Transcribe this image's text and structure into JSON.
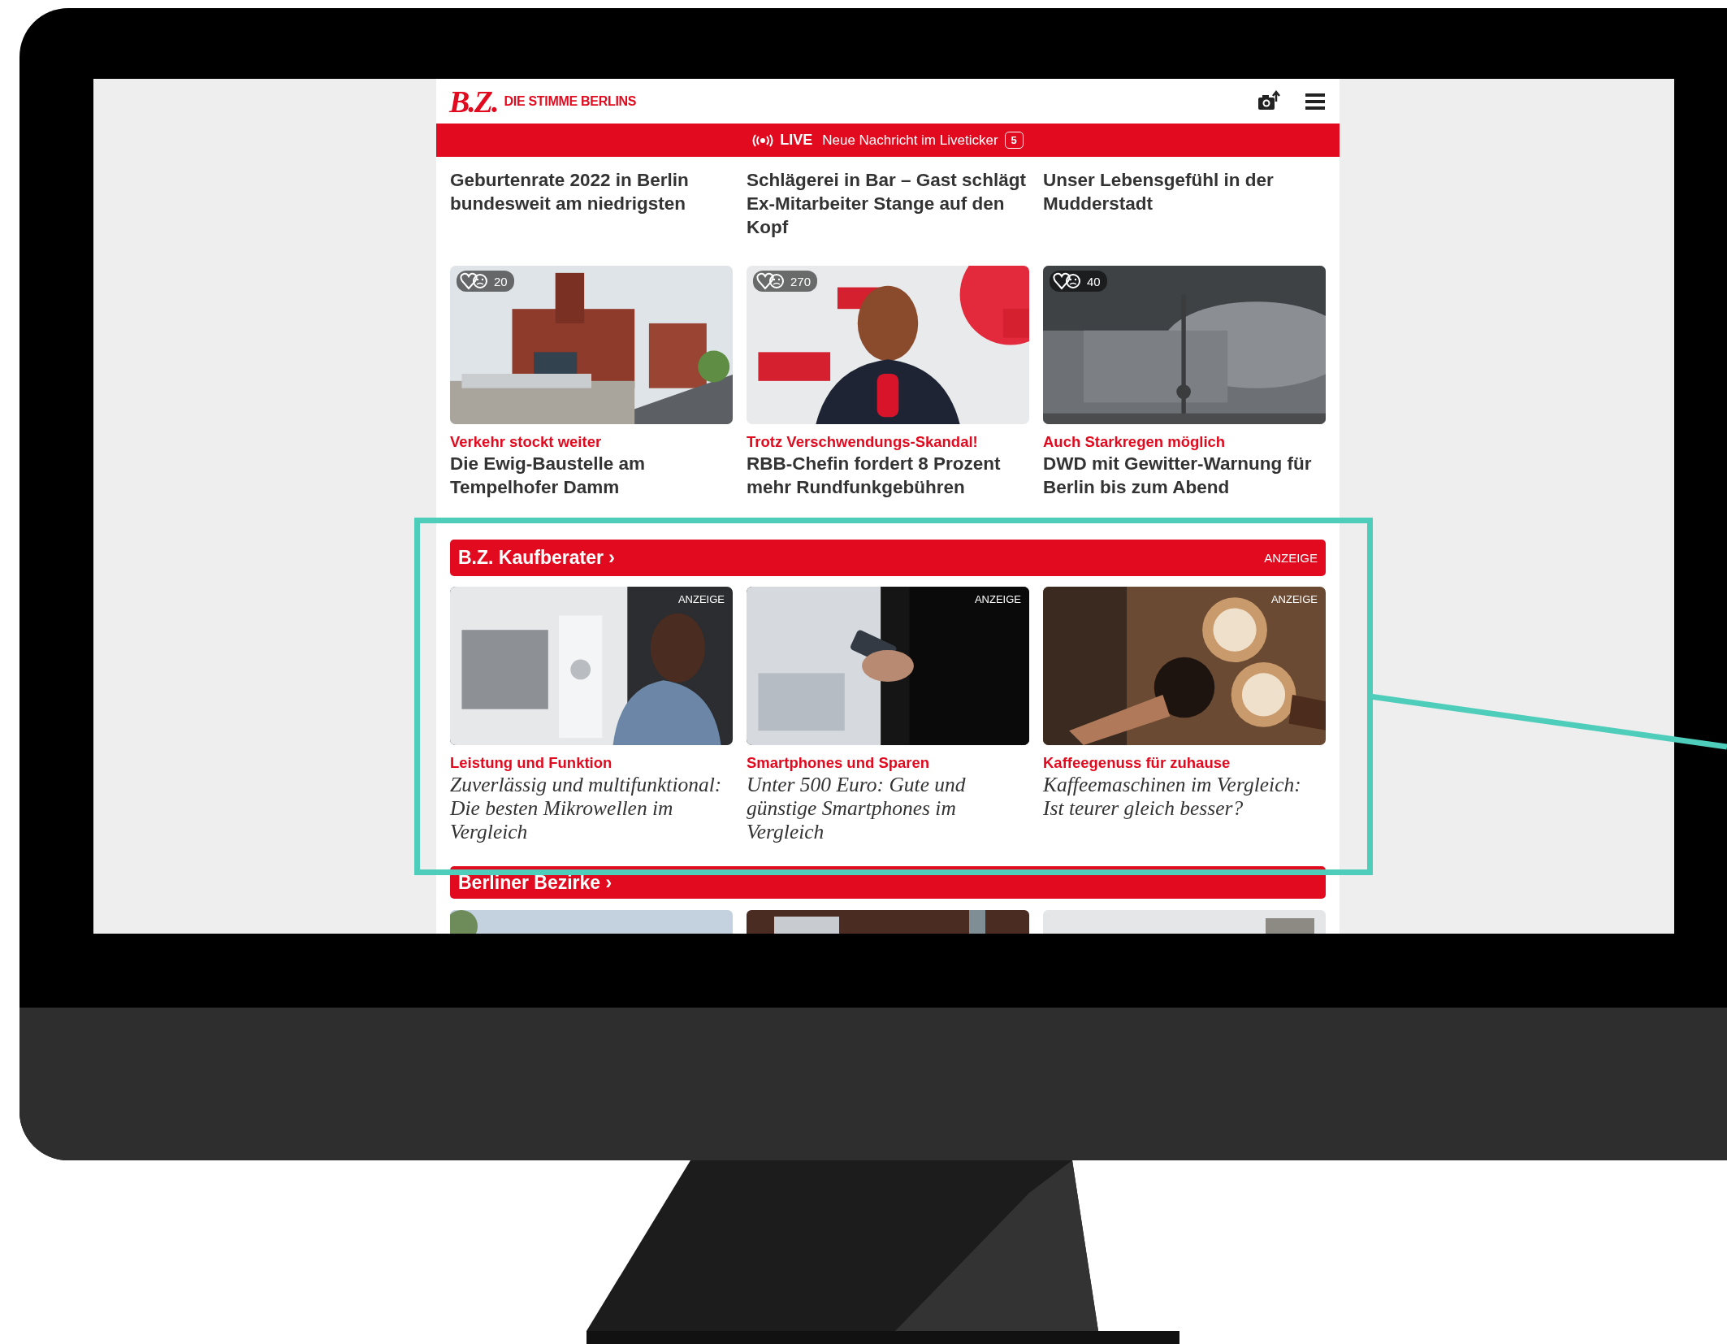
{
  "header": {
    "logo": "B.Z.",
    "tagline": "DIE STIMME BERLINS"
  },
  "live_bar": {
    "label": "LIVE",
    "text": "Neue Nachricht im Liveticker",
    "count": "5"
  },
  "top_articles": [
    {
      "title": "Geburtenrate 2022 in Berlin bundesweit am niedrigsten"
    },
    {
      "title": "Schlägerei in Bar – Gast schlägt Ex-Mitarbeiter Stange auf den Kopf"
    },
    {
      "title": "Unser Lebensgefühl in der Mudderstadt"
    }
  ],
  "articles": [
    {
      "comments": "20",
      "kicker": "Verkehr stockt weiter",
      "title": "Die Ewig-Baustelle am Tempelhofer Damm"
    },
    {
      "comments": "270",
      "kicker": "Trotz Verschwendungs-Skandal!",
      "title": "RBB-Chefin fordert 8 Prozent mehr Rundfunkgebühren"
    },
    {
      "comments": "40",
      "kicker": "Auch Starkregen möglich",
      "title": "DWD mit Gewitter-Warnung für Berlin bis zum Abend"
    }
  ],
  "kaufberater": {
    "title": "B.Z. Kaufberater ›",
    "ad_label": "ANZEIGE",
    "items": [
      {
        "ad_label": "ANZEIGE",
        "kicker": "Leistung und Funktion",
        "title": "Zuverlässig und multifunktional: Die besten Mikrowellen im Vergleich"
      },
      {
        "ad_label": "ANZEIGE",
        "kicker": "Smartphones und Sparen",
        "title": "Unter 500 Euro: Gute und günstige Smartphones im Vergleich"
      },
      {
        "ad_label": "ANZEIGE",
        "kicker": "Kaffeegenuss für zuhause",
        "title": "Kaffeemaschinen im Vergleich: Ist teurer gleich besser?"
      }
    ]
  },
  "bezirke": {
    "title": "Berliner Bezirke ›"
  }
}
